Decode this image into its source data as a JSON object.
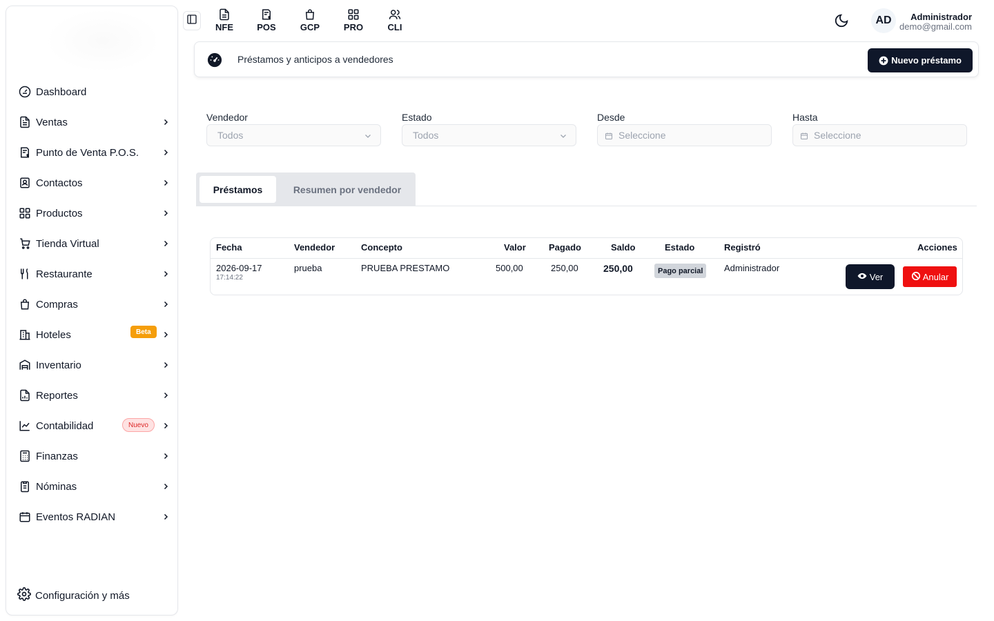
{
  "sidebar": {
    "items": [
      {
        "label": "Dashboard",
        "icon": "gauge-icon",
        "has_chevron": false
      },
      {
        "label": "Ventas",
        "icon": "document-icon",
        "has_chevron": true
      },
      {
        "label": "Punto de Venta P.O.S.",
        "icon": "pos-receipt-icon",
        "has_chevron": true
      },
      {
        "label": "Contactos",
        "icon": "contact-book-icon",
        "has_chevron": true
      },
      {
        "label": "Productos",
        "icon": "grid-icon",
        "has_chevron": true
      },
      {
        "label": "Tienda Virtual",
        "icon": "cart-icon",
        "has_chevron": true
      },
      {
        "label": "Restaurante",
        "icon": "utensils-icon",
        "has_chevron": true
      },
      {
        "label": "Compras",
        "icon": "shopping-bag-icon",
        "has_chevron": true
      },
      {
        "label": "Hoteles",
        "icon": "building-icon",
        "has_chevron": true,
        "badge": "Beta"
      },
      {
        "label": "Inventario",
        "icon": "warehouse-icon",
        "has_chevron": true
      },
      {
        "label": "Reportes",
        "icon": "report-icon",
        "has_chevron": true
      },
      {
        "label": "Contabilidad",
        "icon": "chart-line-icon",
        "has_chevron": true,
        "badge": "Nuevo"
      },
      {
        "label": "Finanzas",
        "icon": "calculator-icon",
        "has_chevron": true
      },
      {
        "label": "Nóminas",
        "icon": "clipboard-icon",
        "has_chevron": true
      },
      {
        "label": "Eventos RADIAN",
        "icon": "calendar-icon",
        "has_chevron": true
      }
    ],
    "config_label": "Configuración y más"
  },
  "topbar": {
    "modules": [
      "NFE",
      "POS",
      "GCP",
      "PRO",
      "CLI"
    ],
    "user_initials": "AD",
    "user_name": "Administrador",
    "user_email": "demo@gmail.com"
  },
  "header": {
    "title": "Préstamos y anticipos a vendedores",
    "new_button": "Nuevo préstamo"
  },
  "filters": {
    "vendedor": {
      "label": "Vendedor",
      "placeholder": "Todos"
    },
    "estado": {
      "label": "Estado",
      "placeholder": "Todos"
    },
    "desde": {
      "label": "Desde",
      "placeholder": "Seleccione"
    },
    "hasta": {
      "label": "Hasta",
      "placeholder": "Seleccione"
    }
  },
  "tabs": {
    "active": "Préstamos",
    "inactive": "Resumen por vendedor"
  },
  "table": {
    "headers": [
      "Fecha",
      "Vendedor",
      "Concepto",
      "Valor",
      "Pagado",
      "Saldo",
      "Estado",
      "Registró",
      "Acciones"
    ],
    "rows": [
      {
        "fecha": "2026-09-17",
        "hora": "17:14:22",
        "vendedor": "prueba",
        "concepto": "PRUEBA PRESTAMO",
        "valor": "500,00",
        "pagado": "250,00",
        "saldo": "250,00",
        "estado": "Pago parcial",
        "registro": "Administrador",
        "btn_ver": "Ver",
        "btn_anular": "Anular"
      }
    ]
  },
  "colors": {
    "primary_dark": "#0f172a",
    "danger": "#ef1010",
    "beta_badge": "#f59e0b",
    "new_badge_text": "#dc2626"
  }
}
